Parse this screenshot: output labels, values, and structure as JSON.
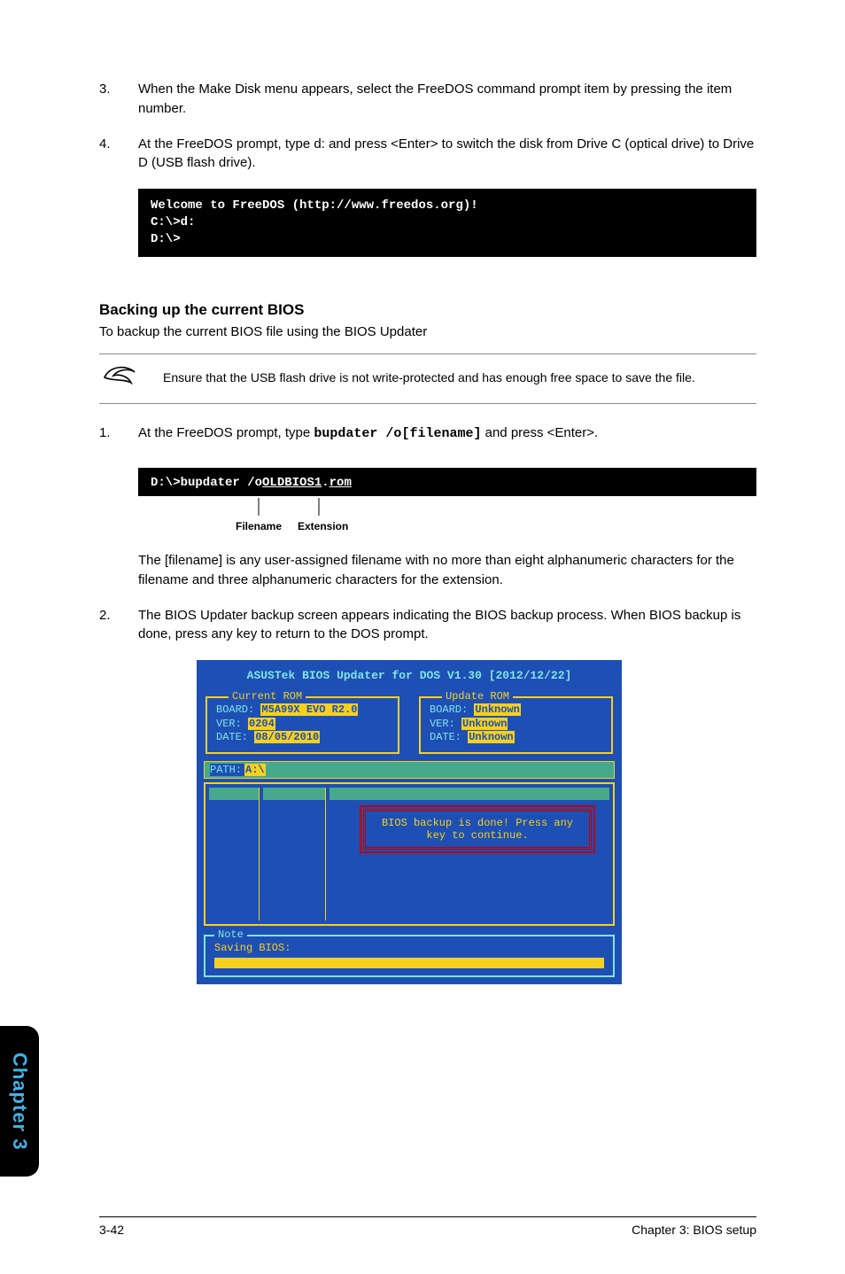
{
  "steps_a": [
    {
      "num": "3.",
      "text": "When the Make Disk menu appears, select the FreeDOS command prompt item by pressing the item number."
    },
    {
      "num": "4.",
      "text": "At the FreeDOS prompt, type d: and press <Enter> to switch the disk from Drive C (optical drive) to Drive D (USB flash drive)."
    }
  ],
  "terminal1": "Welcome to FreeDOS (http://www.freedos.org)!\nC:\\>d:\nD:\\>",
  "section_heading": "Backing up the current BIOS",
  "section_desc": "To backup the current BIOS file using the BIOS Updater",
  "note1": "Ensure that the USB flash drive is not write-protected and has enough free space to save the file.",
  "step_b1_num": "1.",
  "step_b1_pre": "At the FreeDOS prompt, type ",
  "step_b1_code": "bupdater /o[filename]",
  "step_b1_post": " and press <Enter>.",
  "terminal2_prefix": "D:\\>bupdater /o",
  "terminal2_file": "OLDBIOS1",
  "terminal2_dot": ".",
  "terminal2_ext": "rom",
  "label_filename": "Filename",
  "label_extension": "Extension",
  "indent_para": "The [filename] is any user-assigned filename with no more than eight alphanumeric characters for the filename and three alphanumeric characters for the extension.",
  "step_b2_num": "2.",
  "step_b2_text": "The BIOS Updater backup screen appears indicating the BIOS backup process. When BIOS backup is done, press any key to return to the DOS prompt.",
  "bios": {
    "title": "ASUSTek BIOS Updater for DOS V1.30 [2012/12/22]",
    "current_legend": "Current ROM",
    "update_legend": "Update ROM",
    "board_label": "BOARD:",
    "ver_label": "VER:",
    "date_label": "DATE:",
    "current_board": "M5A99X EVO R2.0",
    "current_ver": "0204",
    "current_date": "08/05/2010",
    "update_board": "Unknown",
    "update_ver": "Unknown",
    "update_date": "Unknown",
    "path_label": "PATH:",
    "path_value": "A:\\",
    "message": "BIOS backup is done! Press any key to continue.",
    "note_legend": "Note",
    "saving": "Saving BIOS:"
  },
  "side_tab": "Chapter 3",
  "footer_left": "3-42",
  "footer_right": "Chapter 3: BIOS setup"
}
